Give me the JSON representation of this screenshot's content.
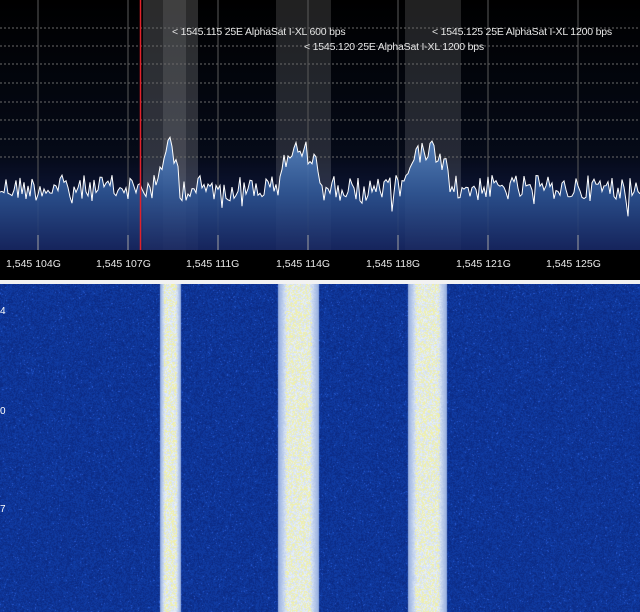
{
  "annotations": [
    {
      "text": "< 1545.115 25E AlphaSat I-XL 600 bps"
    },
    {
      "text": "< 1545.125 25E AlphaSat I-XL 1200 bps"
    },
    {
      "text": "< 1545.120 25E AlphaSat I-XL 1200 bps"
    }
  ],
  "freq_labels": [
    "1,545 104G",
    "1,545 107G",
    "1,545 111G",
    "1,545 114G",
    "1,545 118G",
    "1,545 121G",
    "1,545 125G"
  ],
  "waterfall_marks": [
    "4",
    "0",
    "7"
  ],
  "colors": {
    "trace": "#ffffff",
    "tuning_line": "#e0222a",
    "waterfall_bg": "#061a6e",
    "signal_fill": "#3f6fb0"
  }
}
